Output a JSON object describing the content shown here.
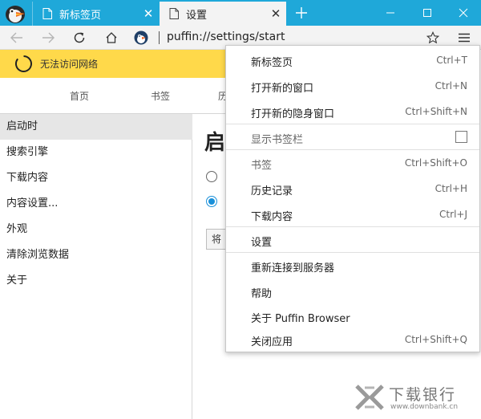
{
  "tabs": [
    {
      "title": "新标签页",
      "active": false
    },
    {
      "title": "设置",
      "active": true
    }
  ],
  "address_bar": {
    "url": "puffin://settings/start"
  },
  "banner": {
    "text": "无法访问网络",
    "color": "#ffd94a"
  },
  "topnav": {
    "items": [
      "首页",
      "书签",
      "历"
    ]
  },
  "sidebar": {
    "items": [
      "启动时",
      "搜索引擎",
      "下载内容",
      "内容设置...",
      "外观",
      "清除浏览数据",
      "关于"
    ],
    "selected_index": 0
  },
  "main": {
    "heading": "启",
    "radio_1_selected": false,
    "radio_2_selected": true,
    "button_label": "将"
  },
  "menu": {
    "items": [
      {
        "label": "新标签页",
        "shortcut": "Ctrl+T"
      },
      {
        "label": "打开新的窗口",
        "shortcut": "Ctrl+N"
      },
      {
        "label": "打开新的隐身窗口",
        "shortcut": "Ctrl+Shift+N"
      },
      {
        "label": "显示书签栏",
        "checked": false
      },
      {
        "label": "书签",
        "shortcut": "Ctrl+Shift+O"
      },
      {
        "label": "历史记录",
        "shortcut": "Ctrl+H"
      },
      {
        "label": "下载内容",
        "shortcut": "Ctrl+J"
      },
      {
        "label": "设置"
      },
      {
        "label": "重新连接到服务器"
      },
      {
        "label": "帮助"
      },
      {
        "label": "关于 Puffin Browser"
      },
      {
        "label": "关闭应用",
        "shortcut": "Ctrl+Shift+Q"
      }
    ]
  },
  "watermark": {
    "text": "下载银行",
    "sub": "www.downbank.cn"
  },
  "colors": {
    "titlebar": "#1fa8d9",
    "accent": "#1a90d9"
  }
}
